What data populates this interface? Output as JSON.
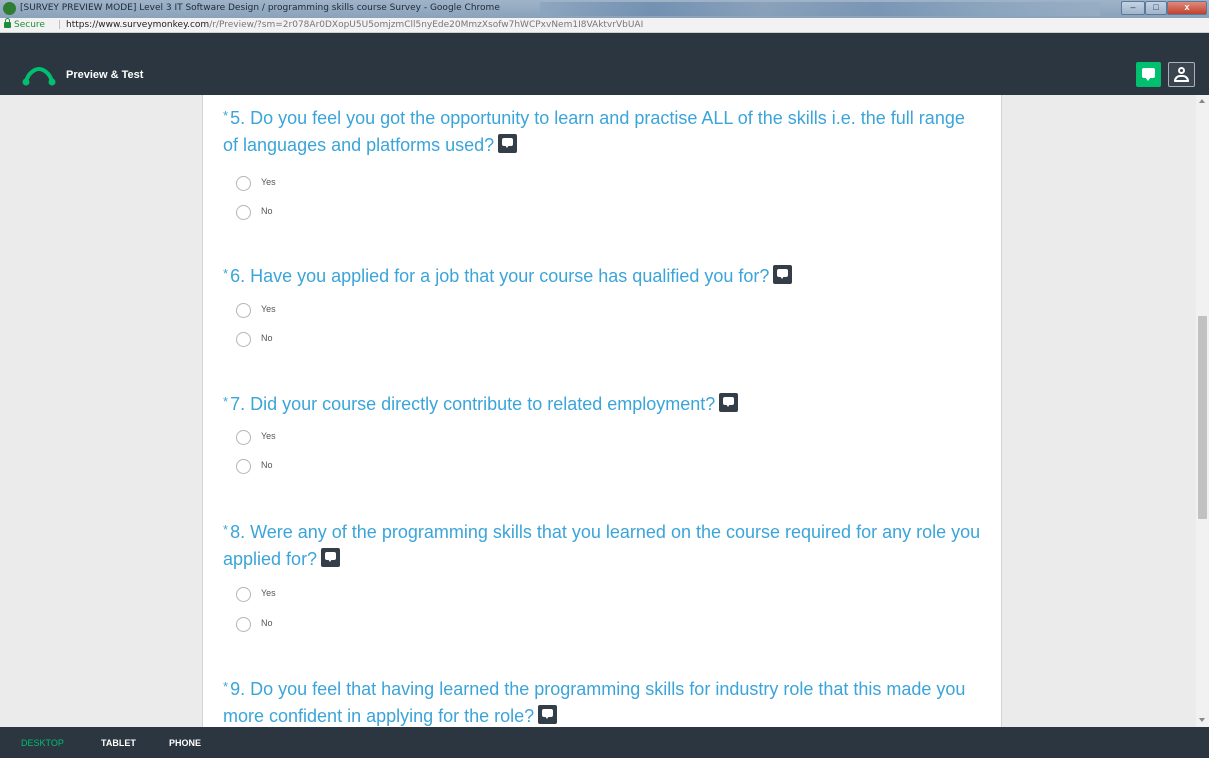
{
  "browser": {
    "window_title": "[SURVEY PREVIEW MODE] Level 3 IT Software Design / programming skills course Survey - Google Chrome",
    "win_min": "–",
    "win_max": "□",
    "win_close": "x",
    "secure_label": "Secure",
    "separator": "|",
    "url_host": "https://www.surveymonkey.com",
    "url_path": "/r/Preview/?sm=2r078Ar0DXopU5U5omjzmCll5nyEde20MmzXsofw7hWCPxvNem1I8VAktvrVbUAI"
  },
  "header": {
    "title": "Preview & Test",
    "logo_icon": "surveymonkey-logo-icon",
    "comment_icon": "comment-icon",
    "user_icon": "user-icon",
    "accent_color": "#00bf6f",
    "bar_color": "#2b3640"
  },
  "questions": [
    {
      "required_mark": "*",
      "title": "5. Do you feel you got the opportunity to learn and practise ALL of the skills i.e. the full range of languages and platforms used?",
      "options": [
        "Yes",
        "No"
      ]
    },
    {
      "required_mark": "*",
      "title": "6. Have you applied for a job that your course has qualified you for?",
      "options": [
        "Yes",
        "No"
      ]
    },
    {
      "required_mark": "*",
      "title": "7. Did your course directly contribute to related employment?",
      "options": [
        "Yes",
        "No"
      ]
    },
    {
      "required_mark": "*",
      "title": "8. Were any of the programming skills that you learned on the course required for any role you applied for?",
      "options": [
        "Yes",
        "No"
      ]
    },
    {
      "required_mark": "*",
      "title": "9. Do you feel that having learned the programming skills for industry role that this made you more confident in applying for the role?",
      "options": []
    }
  ],
  "question_color": "#3ba4d9",
  "footer": {
    "tabs": [
      "DESKTOP",
      "TABLET",
      "PHONE"
    ],
    "active": "DESKTOP"
  }
}
